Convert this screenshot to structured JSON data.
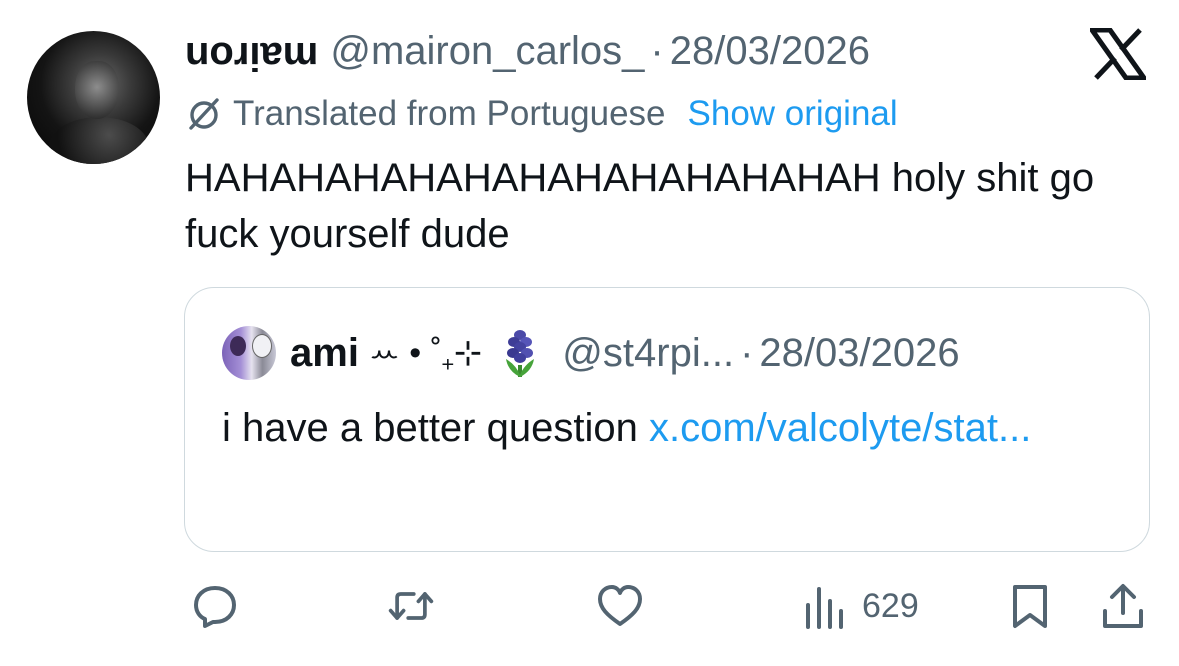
{
  "tweet": {
    "display_name": "uoɹᴉɐɯ",
    "handle": "@mairon_carlos_",
    "separator": "·",
    "date": "28/03/2026",
    "translated_label": "Translated from Portuguese",
    "show_original": "Show original",
    "text": "HAHAHAHAHAHAHAHAHAHAHAHAH holy shit go fuck yourself dude",
    "avatar_icon": "profile-photo"
  },
  "quote": {
    "display_name": "ami",
    "name_decoration": "ꕀ • ˚₊⊹",
    "emoji": "hyacinth",
    "handle": "@st4rpi...",
    "separator": "·",
    "date": "28/03/2026",
    "text": "i have a better question",
    "link_text": "x.com/valcolyte/stat..."
  },
  "actions": {
    "reply_icon": "reply-icon",
    "retweet_icon": "retweet-icon",
    "like_icon": "heart-icon",
    "views_icon": "views-icon",
    "views_count": "629",
    "bookmark_icon": "bookmark-icon",
    "share_icon": "share-icon"
  },
  "colors": {
    "text": "#0f1419",
    "secondary": "#536471",
    "link": "#1d9bf0",
    "border": "#cfd9de"
  }
}
